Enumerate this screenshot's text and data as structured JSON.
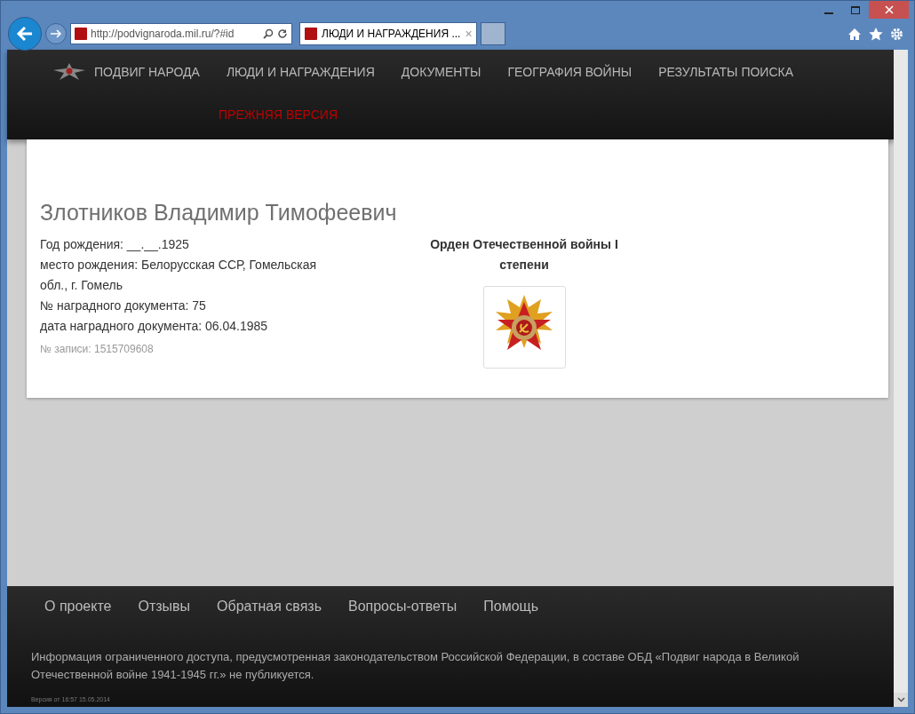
{
  "browser": {
    "address": "http://podvignaroda.mil.ru/?#id",
    "tabs": [
      {
        "title": "ЛЮДИ И НАГРАЖДЕНИЯ ...",
        "close": "×",
        "selected": true
      }
    ]
  },
  "nav": {
    "items": [
      {
        "label": "ПОДВИГ НАРОДА",
        "kind": "brand"
      },
      {
        "label": "ЛЮДИ И НАГРАЖДЕНИЯ",
        "kind": "link"
      },
      {
        "label": "ДОКУМЕНТЫ",
        "kind": "link"
      },
      {
        "label": "ГЕОГРАФИЯ ВОЙНЫ",
        "kind": "link"
      },
      {
        "label": "РЕЗУЛЬТАТЫ ПОИСКА",
        "kind": "link"
      }
    ],
    "secondary": "ПРЕЖНЯЯ ВЕРСИЯ"
  },
  "record": {
    "name": "Злотников Владимир Тимофеевич",
    "fields": [
      "Год рождения: __.__.1925",
      "место рождения: Белорусская ССР, Гомельская обл., г. Гомель",
      "№ наградного документа: 75",
      "дата наградного документа: 06.04.1985"
    ],
    "record_number": "№ записи: 1515709608",
    "award": "Орден Отечественной войны I степени"
  },
  "footer": {
    "links": [
      "О проекте",
      "Отзывы",
      "Обратная связь",
      "Вопросы-ответы",
      "Помощь"
    ],
    "notice": "Информация ограниченного доступа, предусмотренная законодательством Российской Федерации, в составе ОБД «Подвиг народа в Великой Отечественной войне 1941-1945 гг.» не публикуется.",
    "version": "Версия от 16:57 15.05.2014"
  }
}
